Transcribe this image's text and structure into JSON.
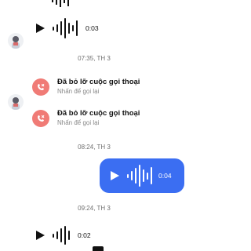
{
  "messages": {
    "audio_top": {
      "duration": "0:03"
    },
    "timestamp1": "07:35, TH 3",
    "missed_call_1": {
      "title": "Đã bỏ lỡ cuộc gọi thoại",
      "subtitle": "Nhấn để gọi lại"
    },
    "missed_call_2": {
      "title": "Đã bỏ lỡ cuộc gọi thoại",
      "subtitle": "Nhấn để gọi lại"
    },
    "timestamp2": "08:24, TH 3",
    "audio_outgoing": {
      "duration": "0:04"
    },
    "timestamp3": "09:24, TH 3",
    "audio_bottom": {
      "duration": "0:02"
    }
  },
  "colors": {
    "outgoing_bubble": "#3b6ef2",
    "missed_call_icon": "#f07b76"
  },
  "icons": {
    "play": "play-icon",
    "missed_call": "missed-call-icon",
    "avatar": "avatar-image"
  }
}
